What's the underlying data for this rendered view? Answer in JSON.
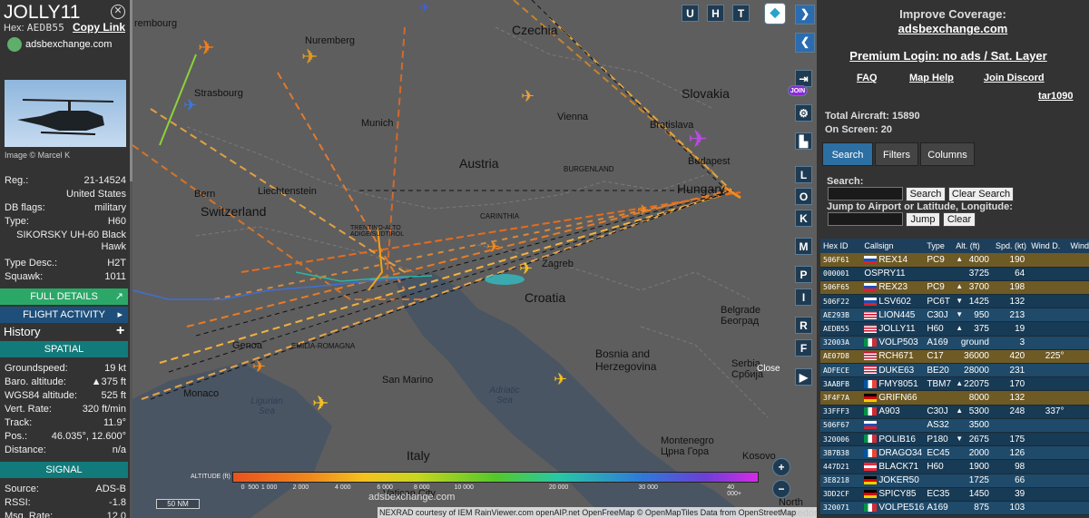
{
  "left_panel": {
    "callsign": "JOLLY11",
    "hex_label": "Hex:",
    "hex": "AEDB55",
    "copy_link": "Copy Link",
    "site_name": "adsbexchange.com",
    "photo_credit": "Image © Marcel K",
    "reg_label": "Reg.:",
    "reg": "21-14524",
    "country": "United States",
    "db_flags_label": "DB flags:",
    "db_flags": "military",
    "type_label": "Type:",
    "type": "H60",
    "type_full": "SIKORSKY UH-60 Black Hawk",
    "type_desc_label": "Type Desc.:",
    "type_desc": "H2T",
    "squawk_label": "Squawk:",
    "squawk": "1011",
    "full_details": "FULL DETAILS",
    "flight_activity": "FLIGHT ACTIVITY",
    "history": "History",
    "spatial": "SPATIAL",
    "groundspeed_label": "Groundspeed:",
    "groundspeed": "19 kt",
    "baro_label": "Baro. altitude:",
    "baro": "▲375 ft",
    "wgs_label": "WGS84 altitude:",
    "wgs": "525 ft",
    "vert_label": "Vert. Rate:",
    "vert": "320 ft/min",
    "track_label": "Track:",
    "track": "11.9°",
    "pos_label": "Pos.:",
    "pos": "46.035°, 12.600°",
    "distance_label": "Distance:",
    "distance": "n/a",
    "signal": "SIGNAL",
    "source_label": "Source:",
    "source": "ADS-B",
    "rssi_label": "RSSI:",
    "rssi": "-1.8",
    "msg_label": "Msg. Rate:",
    "msg": "12.0"
  },
  "map": {
    "labels": {
      "rembourg": "rembourg",
      "nuremberg": "Nuremberg",
      "czechia": "Czechia",
      "slovakia": "Slovakia",
      "strasbourg": "Strasbourg",
      "munich": "Munich",
      "vienna": "Vienna",
      "bratislava": "Bratislava",
      "budapest": "Budapest",
      "austria": "Austria",
      "burgenland": "BURGENLAND",
      "hungary": "Hungary",
      "bern": "Bern",
      "liechtenstein": "Liechtenstein",
      "switzerland": "Switzerland",
      "carinthia": "CARINTHIA",
      "trentino": "TRENTINO-ALTO ADIGE/SÜDTIROL",
      "zagreb": "Zagreb",
      "croatia": "Croatia",
      "belgrade": "Belgrade Београд",
      "bosnia": "Bosnia and Herzegovina",
      "serbia": "Serbia Србија",
      "genoa": "Genoa",
      "emilia": "EMILIA-ROMAGNA",
      "ligurian": "Ligurian Sea",
      "monaco": "Monaco",
      "san_marino": "San Marino",
      "adriatic": "Adriatic Sea",
      "italy": "Italy",
      "vatican": "Vatican City",
      "montenegro": "Montenegro Црна Гора",
      "kosovo": "Kosovo",
      "north_macedonia": "North Macedonia"
    },
    "buttons": [
      "U",
      "H",
      "T"
    ],
    "side_buttons": [
      "L",
      "O",
      "K",
      "M",
      "P",
      "I",
      "R",
      "F"
    ],
    "join": "JOIN",
    "close": "Close",
    "altitude_title": "ALTITUDE (ft)",
    "altitude_ticks": [
      "0",
      "500",
      "1 000",
      "2 000",
      "4 000",
      "6 000",
      "8 000",
      "10 000",
      "20 000",
      "30 000",
      "40 000+"
    ],
    "scale": "50 NM",
    "watermark": "adsbexchange.com",
    "attribution": "NEXRAD courtesy of IEM RainViewer.com openAIP.net OpenFreeMap © OpenMapTiles Data from OpenStreetMap"
  },
  "right_panel": {
    "improve": "Improve Coverage:",
    "domain": "adsbexchange.com",
    "premium": "Premium Login: no ads / Sat. Layer",
    "faq": "FAQ",
    "map_help": "Map Help",
    "discord": "Join Discord",
    "user": "tar1090",
    "total_label": "Total Aircraft:",
    "total": "15890",
    "onscreen_label": "On Screen:",
    "onscreen": "20",
    "tabs": [
      "Search",
      "Filters",
      "Columns"
    ],
    "search_label": "Search:",
    "search_btn": "Search",
    "clear_search_btn": "Clear Search",
    "jump_label": "Jump to Airport or Latitude, Longitude:",
    "jump_btn": "Jump",
    "clear_btn": "Clear",
    "columns": [
      "Hex ID",
      "Callsign",
      "Type",
      "Alt. (ft)",
      "Spd. (kt)",
      "Wind D.",
      "Wind"
    ],
    "rows": [
      {
        "hex": "506F61",
        "flag": "si",
        "callsign": "REX14",
        "type": "PC9",
        "arrow": "▲",
        "alt": "4000",
        "spd": "190",
        "wind": "",
        "mil": true
      },
      {
        "hex": "000001",
        "flag": "",
        "callsign": "OSPRY11",
        "type": "",
        "arrow": "",
        "alt": "3725",
        "spd": "64",
        "wind": "",
        "mil": false
      },
      {
        "hex": "506F65",
        "flag": "si",
        "callsign": "REX23",
        "type": "PC9",
        "arrow": "▲",
        "alt": "3700",
        "spd": "198",
        "wind": "",
        "mil": true
      },
      {
        "hex": "506F22",
        "flag": "si",
        "callsign": "LSV602",
        "type": "PC6T",
        "arrow": "▼",
        "alt": "1425",
        "spd": "132",
        "wind": "",
        "mil": false
      },
      {
        "hex": "AE293B",
        "flag": "us",
        "callsign": "LION445",
        "type": "C30J",
        "arrow": "▼",
        "alt": "950",
        "spd": "213",
        "wind": "",
        "mil": false
      },
      {
        "hex": "AEDB55",
        "flag": "us",
        "callsign": "JOLLY11",
        "type": "H60",
        "arrow": "▲",
        "alt": "375",
        "spd": "19",
        "wind": "",
        "mil": false
      },
      {
        "hex": "32003A",
        "flag": "it",
        "callsign": "VOLP503",
        "type": "A169",
        "arrow": "",
        "alt": "ground",
        "spd": "3",
        "wind": "",
        "mil": false
      },
      {
        "hex": "AE07D8",
        "flag": "us",
        "callsign": "RCH671",
        "type": "C17",
        "arrow": "",
        "alt": "36000",
        "spd": "420",
        "wind": "225°",
        "mil": true
      },
      {
        "hex": "ADFECE",
        "flag": "us",
        "callsign": "DUKE63",
        "type": "BE20",
        "arrow": "",
        "alt": "28000",
        "spd": "231",
        "wind": "",
        "mil": false
      },
      {
        "hex": "3AABFB",
        "flag": "fr",
        "callsign": "FMY8051",
        "type": "TBM7",
        "arrow": "▲",
        "alt": "22075",
        "spd": "170",
        "wind": "",
        "mil": false
      },
      {
        "hex": "3F4F7A",
        "flag": "de",
        "callsign": "GRIFN66",
        "type": "",
        "arrow": "",
        "alt": "8000",
        "spd": "132",
        "wind": "",
        "mil": true
      },
      {
        "hex": "33FFF3",
        "flag": "it",
        "callsign": "A903",
        "type": "C30J",
        "arrow": "▲",
        "alt": "5300",
        "spd": "248",
        "wind": "337°",
        "mil": false
      },
      {
        "hex": "506F67",
        "flag": "si",
        "callsign": "",
        "type": "AS32",
        "arrow": "",
        "alt": "3500",
        "spd": "",
        "wind": "",
        "mil": false
      },
      {
        "hex": "320006",
        "flag": "it",
        "callsign": "POLIB16",
        "type": "P180",
        "arrow": "▼",
        "alt": "2675",
        "spd": "175",
        "wind": "",
        "mil": false
      },
      {
        "hex": "3B7B38",
        "flag": "fr",
        "callsign": "DRAGO34",
        "type": "EC45",
        "arrow": "",
        "alt": "2000",
        "spd": "126",
        "wind": "",
        "mil": false
      },
      {
        "hex": "447D21",
        "flag": "at",
        "callsign": "BLACK71",
        "type": "H60",
        "arrow": "",
        "alt": "1900",
        "spd": "98",
        "wind": "",
        "mil": false
      },
      {
        "hex": "3E8218",
        "flag": "de",
        "callsign": "JOKER50",
        "type": "",
        "arrow": "",
        "alt": "1725",
        "spd": "66",
        "wind": "",
        "mil": false
      },
      {
        "hex": "3DD2CF",
        "flag": "de",
        "callsign": "SPICY85",
        "type": "EC35",
        "arrow": "",
        "alt": "1450",
        "spd": "39",
        "wind": "",
        "mil": false
      },
      {
        "hex": "320071",
        "flag": "it",
        "callsign": "VOLPE516",
        "type": "A169",
        "arrow": "",
        "alt": "875",
        "spd": "103",
        "wind": "",
        "mil": false
      }
    ]
  }
}
